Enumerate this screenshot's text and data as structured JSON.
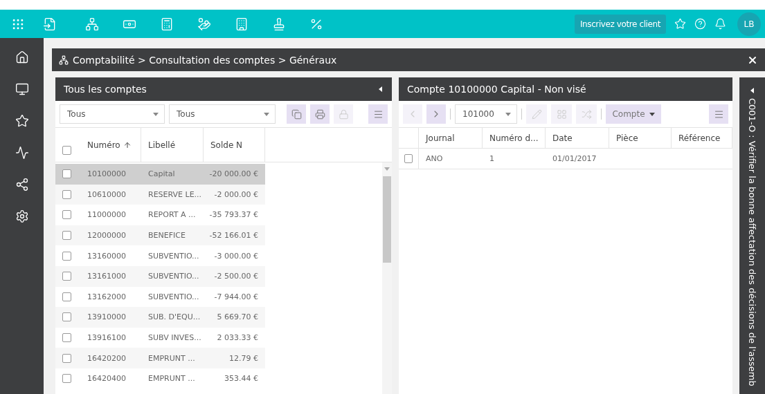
{
  "top_bar": {
    "apps": [
      {
        "kind": "grid"
      },
      {
        "kind": "document"
      },
      {
        "kind": "network"
      },
      {
        "kind": "money"
      },
      {
        "kind": "calculator"
      },
      {
        "kind": "hand-coins"
      },
      {
        "kind": "building"
      },
      {
        "kind": "stamp"
      },
      {
        "kind": "percent"
      }
    ],
    "register_button": "Inscrivez votre client",
    "actions": [
      {
        "kind": "star"
      },
      {
        "kind": "help"
      },
      {
        "kind": "bell"
      }
    ],
    "avatar": "LB"
  },
  "sidebar": {
    "items": [
      {
        "kind": "home"
      },
      {
        "kind": "screen"
      },
      {
        "kind": "star"
      },
      {
        "kind": "chart"
      },
      {
        "kind": "share"
      },
      {
        "kind": "settings"
      }
    ]
  },
  "page": {
    "breadcrumb": "Comptabilité > Consultation des comptes > Généraux"
  },
  "left_panel": {
    "title": "Tous les comptes",
    "filters": [
      {
        "value": "Tous"
      },
      {
        "value": "Tous"
      }
    ],
    "tools": [
      {
        "kind": "copy",
        "disabled": false
      },
      {
        "kind": "print",
        "disabled": false
      },
      {
        "kind": "lock",
        "disabled": true
      },
      {
        "kind": "menu",
        "disabled": false
      }
    ],
    "select_all_checked": false,
    "columns": [
      {
        "label": "Numéro",
        "sorted": true
      },
      {
        "label": "Libellé",
        "sorted": false
      },
      {
        "label": "Solde N",
        "sorted": false
      }
    ],
    "rows": [
      {
        "number": "10100000",
        "label": "Capital",
        "balance": "-20 000.00 €",
        "selected": true,
        "checked": false
      },
      {
        "number": "10610000",
        "label": "RESERVE LE...",
        "balance": "-2 000.00 €",
        "selected": false,
        "checked": false
      },
      {
        "number": "11000000",
        "label": "REPORT A ...",
        "balance": "-35 793.37 €",
        "selected": false,
        "checked": false
      },
      {
        "number": "12000000",
        "label": "BENEFICE",
        "balance": "-52 166.01 €",
        "selected": false,
        "checked": false
      },
      {
        "number": "13160000",
        "label": "SUBVENTIO...",
        "balance": "-3 000.00 €",
        "selected": false,
        "checked": false
      },
      {
        "number": "13161000",
        "label": "SUBVENTIO...",
        "balance": "-2 500.00 €",
        "selected": false,
        "checked": false
      },
      {
        "number": "13162000",
        "label": "SUBVENTIO...",
        "balance": "-7 944.00 €",
        "selected": false,
        "checked": false
      },
      {
        "number": "13910000",
        "label": "SUB. D'EQU...",
        "balance": "5 669.70 €",
        "selected": false,
        "checked": false
      },
      {
        "number": "13916100",
        "label": "SUBV INVES...",
        "balance": "2 033.33 €",
        "selected": false,
        "checked": false
      },
      {
        "number": "16420200",
        "label": "EMPRUNT ...",
        "balance": "12.79 €",
        "selected": false,
        "checked": false
      },
      {
        "number": "16420400",
        "label": "EMPRUNT ...",
        "balance": "353.44 €",
        "selected": false,
        "checked": false
      }
    ]
  },
  "right_panel": {
    "title": "Compte 10100000 Capital - Non visé",
    "nav": [
      {
        "kind": "previous",
        "disabled": true
      },
      {
        "kind": "next",
        "disabled": false
      }
    ],
    "account_select": "101000",
    "tools": [
      {
        "kind": "edit",
        "disabled": true
      },
      {
        "kind": "layout",
        "disabled": true
      },
      {
        "kind": "shuffle",
        "disabled": true
      }
    ],
    "view_button": "Compte",
    "menu": {
      "kind": "menu",
      "disabled": false
    },
    "columns": [
      "Journal",
      "Numéro d...",
      "Date",
      "Pièce",
      "Référence"
    ],
    "rows": [
      {
        "journal": "ANO",
        "number": "1",
        "date": "01/01/2017",
        "checked": false
      }
    ]
  },
  "side_note": "C001-O : Vérifier la bonne affectation des décisions de l'assemb"
}
